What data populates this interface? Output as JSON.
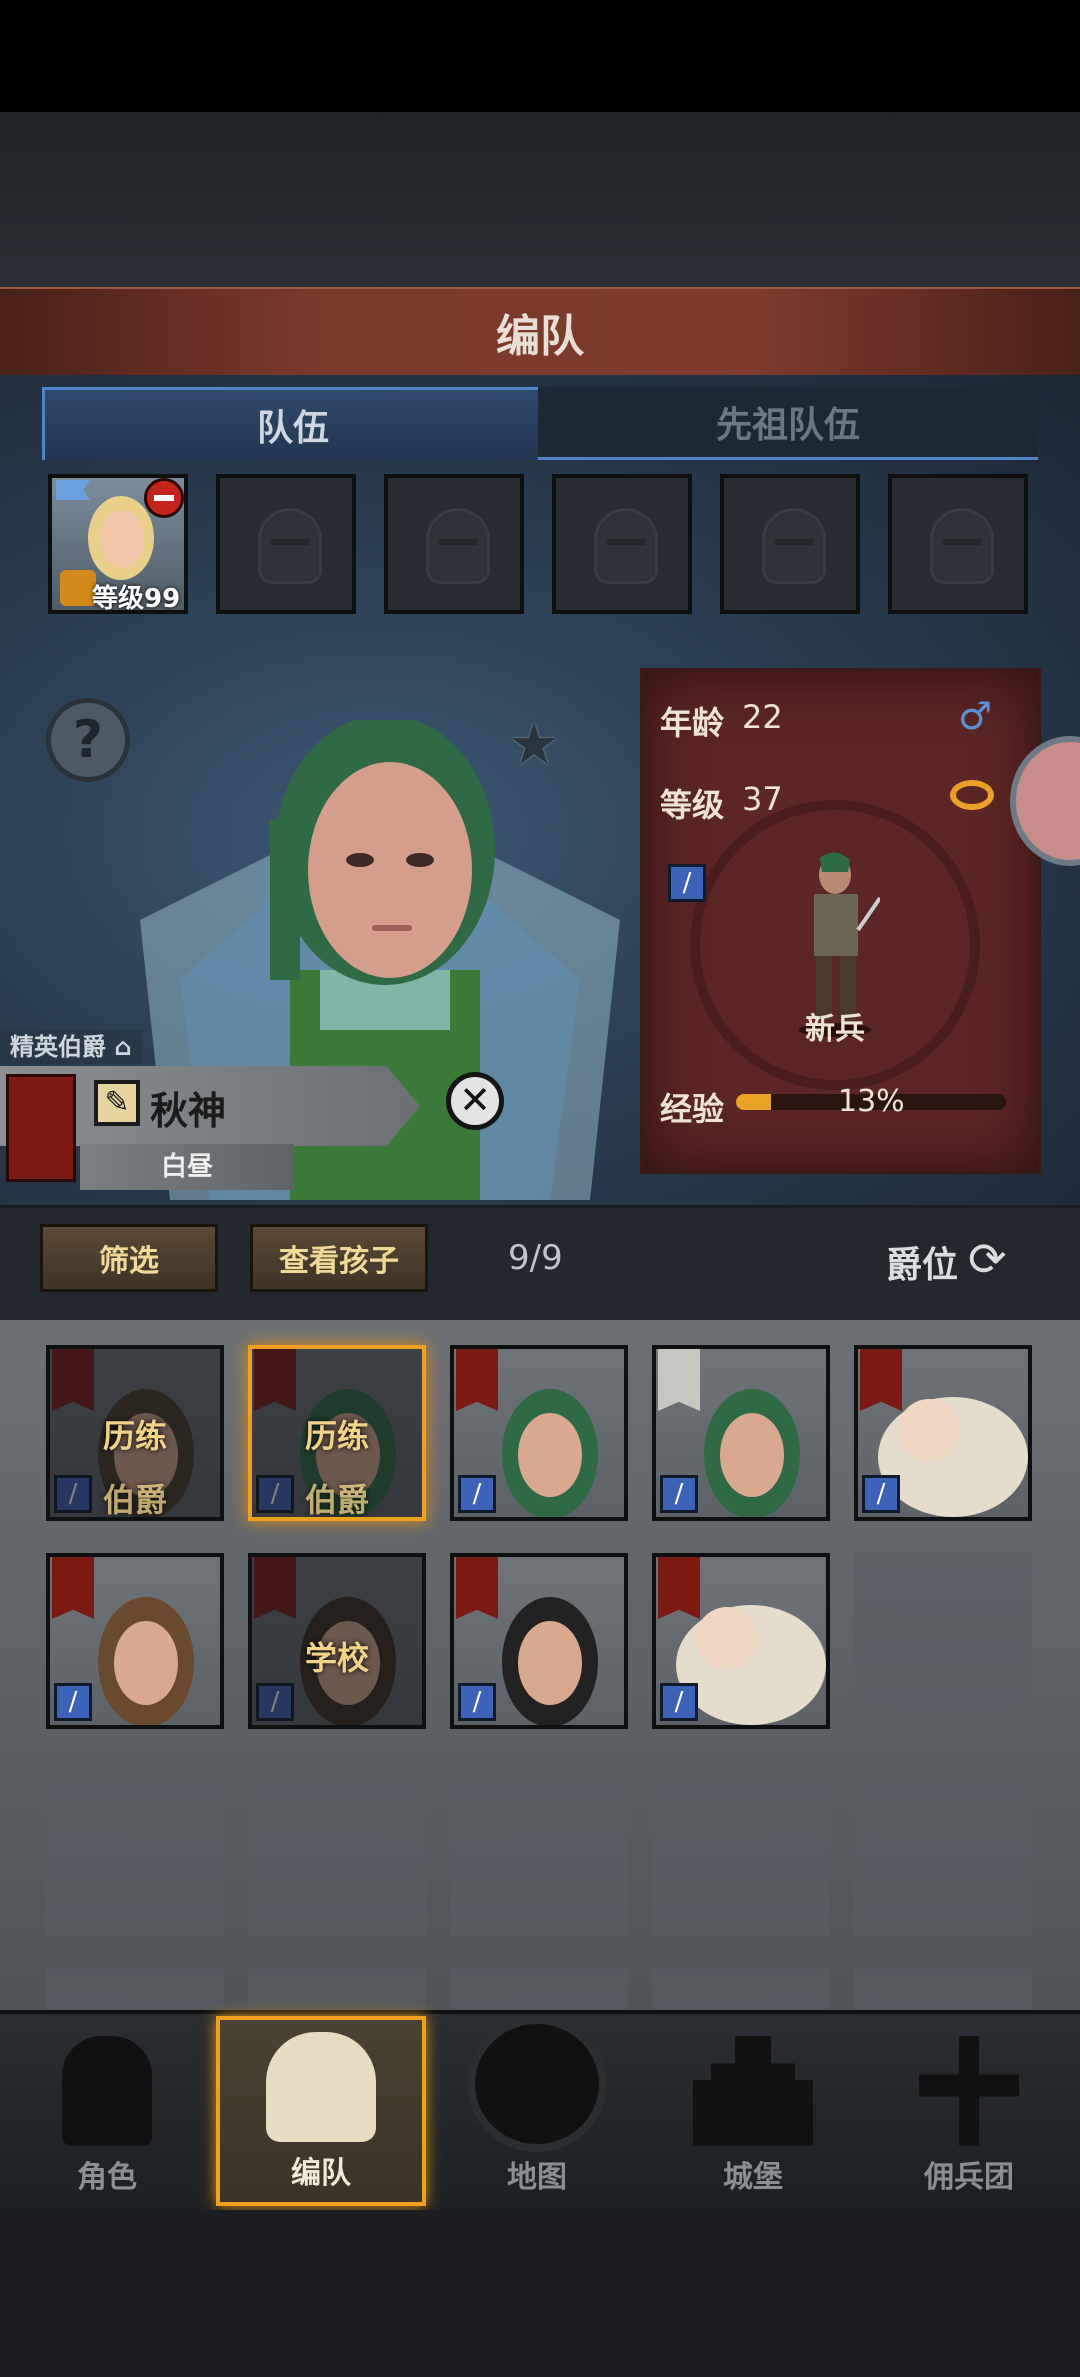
{
  "header": {
    "title": "编队"
  },
  "tabs": [
    {
      "label": "队伍",
      "active": true
    },
    {
      "label": "先祖队伍",
      "active": false
    }
  ],
  "team": {
    "leader_level": "等级99",
    "empty_slots": 5
  },
  "character": {
    "title": "精英伯爵",
    "name": "秋神",
    "subtitle": "白昼",
    "age_label": "年龄",
    "age": "22",
    "level_label": "等级",
    "level": "37",
    "class": "新兵",
    "exp_label": "经验",
    "exp_percent": "13%",
    "exp_fraction": 0.13
  },
  "filter": {
    "filter_label": "筛选",
    "children_label": "查看孩子",
    "count": "9/9",
    "sort_label": "爵位"
  },
  "roster": [
    {
      "overlay1": "历练",
      "overlay2": "伯爵",
      "banner": "red",
      "dim": true
    },
    {
      "overlay1": "历练",
      "overlay2": "伯爵",
      "banner": "red",
      "dim": true,
      "selected": true
    },
    {
      "overlay1": "",
      "overlay2": "",
      "banner": "red",
      "dim": false
    },
    {
      "overlay1": "",
      "overlay2": "",
      "banner": "white",
      "dim": false
    },
    {
      "overlay1": "",
      "overlay2": "",
      "banner": "red",
      "dim": false,
      "baby": true
    },
    {
      "overlay1": "",
      "overlay2": "",
      "banner": "red",
      "dim": false
    },
    {
      "overlay1": "学校",
      "overlay2": "",
      "banner": "red",
      "dim": true
    },
    {
      "overlay1": "",
      "overlay2": "",
      "banner": "red",
      "dim": false
    },
    {
      "overlay1": "",
      "overlay2": "",
      "banner": "red",
      "dim": false,
      "baby": true
    }
  ],
  "nav": [
    {
      "label": "角色",
      "icon": "knight-icon"
    },
    {
      "label": "编队",
      "icon": "helmet-icon",
      "active": true
    },
    {
      "label": "地图",
      "icon": "compass-icon"
    },
    {
      "label": "城堡",
      "icon": "castle-icon"
    },
    {
      "label": "佣兵团",
      "icon": "mercenary-icon"
    }
  ]
}
